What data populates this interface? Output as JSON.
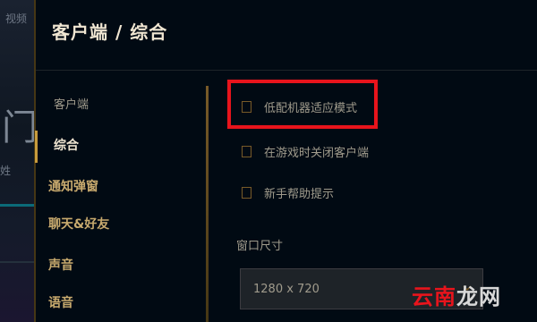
{
  "background": {
    "top_text": "视频",
    "mid_text": "门",
    "small_text": "姓"
  },
  "header": {
    "title": "客户端 / 综合"
  },
  "nav": {
    "category": "客户端",
    "items": [
      {
        "label": "综合",
        "active": true
      },
      {
        "label": "通知弹窗",
        "active": false
      },
      {
        "label": "聊天&好友",
        "active": false
      },
      {
        "label": "声音",
        "active": false
      },
      {
        "label": "语音",
        "active": false
      }
    ]
  },
  "options": [
    {
      "label": "低配机器适应模式",
      "checked": false,
      "highlighted": true
    },
    {
      "label": "在游戏时关闭客户端",
      "checked": false
    },
    {
      "label": "新手帮助提示",
      "checked": false
    }
  ],
  "window_size": {
    "label": "窗口尺寸",
    "value": "1280 x 720"
  },
  "watermark": {
    "red": "云南",
    "rest": "龙网"
  },
  "colors": {
    "accent_gold": "#c89b3c",
    "highlight_red": "#e8141c",
    "text_light": "#f0e6d2",
    "text_muted": "#a09b8c",
    "background": "#010a13"
  }
}
